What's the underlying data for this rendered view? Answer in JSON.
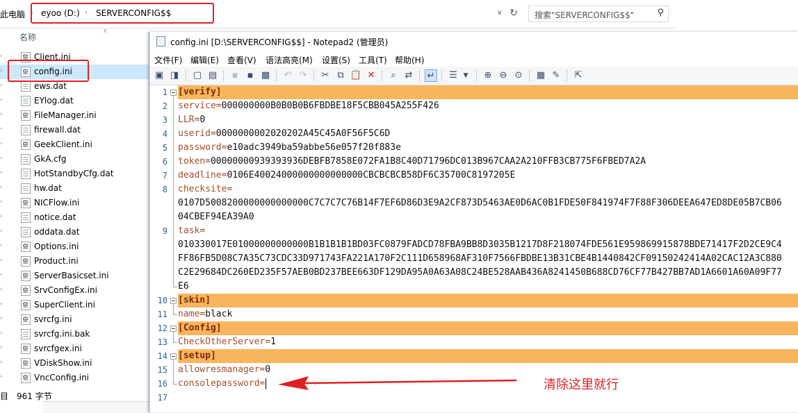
{
  "explorer": {
    "address": {
      "this_pc": "此电脑",
      "drive": "eyoo (D:)",
      "folder": "SERVERCONFIG$$"
    },
    "search_placeholder": "搜索\"SERVERCONFIG$$\"",
    "column_name": "名称",
    "files": [
      {
        "name": "Client.ini",
        "icon": "ini-file-icon"
      },
      {
        "name": "config.ini",
        "icon": "ini-file-icon",
        "selected": true
      },
      {
        "name": "ews.dat",
        "icon": "dat-file-icon"
      },
      {
        "name": "EYlog.dat",
        "icon": "dat-file-icon"
      },
      {
        "name": "FileManager.ini",
        "icon": "ini-file-icon"
      },
      {
        "name": "firewall.dat",
        "icon": "dat-file-icon"
      },
      {
        "name": "GeekClient.ini",
        "icon": "ini-file-icon"
      },
      {
        "name": "GkA.cfg",
        "icon": "cfg-file-icon"
      },
      {
        "name": "HotStandbyCfg.dat",
        "icon": "dat-file-icon"
      },
      {
        "name": "hw.dat",
        "icon": "dat-file-icon"
      },
      {
        "name": "NICFlow.ini",
        "icon": "ini-file-icon"
      },
      {
        "name": "notice.dat",
        "icon": "dat-file-icon"
      },
      {
        "name": "oddata.dat",
        "icon": "dat-file-icon"
      },
      {
        "name": "Options.ini",
        "icon": "ini-file-icon"
      },
      {
        "name": "Product.ini",
        "icon": "ini-file-icon"
      },
      {
        "name": "ServerBasicset.ini",
        "icon": "ini-file-icon"
      },
      {
        "name": "SrvConfigEx.ini",
        "icon": "ini-file-icon"
      },
      {
        "name": "SuperClient.ini",
        "icon": "ini-file-icon"
      },
      {
        "name": "svrcfg.ini",
        "icon": "ini-file-icon"
      },
      {
        "name": "svrcfg.ini.bak",
        "icon": "bak-file-icon"
      },
      {
        "name": "svrcfgex.ini",
        "icon": "ini-file-icon"
      },
      {
        "name": "VDiskShow.ini",
        "icon": "ini-file-icon"
      },
      {
        "name": "VncConfig.ini",
        "icon": "ini-file-icon"
      }
    ],
    "status": {
      "items": "目",
      "size": "961 字节"
    }
  },
  "notepad": {
    "title": "config.ini [D:\\SERVERCONFIG$$] - Notepad2 (管理员)",
    "menu": [
      "文件(F)",
      "编辑(E)",
      "查看(V)",
      "语法高亮(M)",
      "设置(S)",
      "工具(T)",
      "帮助(H)"
    ],
    "lines": [
      {
        "n": "1",
        "section": "[verify]"
      },
      {
        "n": "2",
        "key": "service",
        "value": "000000000B0B0B0B6FBDBE18F5CBB045A255F426"
      },
      {
        "n": "3",
        "key": "LLR",
        "value": "0"
      },
      {
        "n": "4",
        "key": "userid",
        "value": "0000000002020202A45C45A0F56F5C6D"
      },
      {
        "n": "5",
        "key": "password",
        "value": "e10adc3949ba59abbe56e057f20f883e"
      },
      {
        "n": "6",
        "key": "token",
        "value": "00000000939393936DEBFB7858E072FA1B8C40D71796DC013B967CAA2A210FFB3CB775F6FBED7A2A"
      },
      {
        "n": "7",
        "key": "deadline",
        "value": "0106E40024000000000000000CBCBCBCB58DF6C35700C8197205E"
      },
      {
        "n": "8",
        "key": "checksite",
        "value": "",
        "cont": [
          "0107D5008200000000000000C7C7C7C76B14F7EF6D86D3E9A2CF873D5463AE0D6AC0B1FDE50F841974F7F88F306DEEA647ED8DE05B7CB06",
          "04CBEF94EA39A0"
        ]
      },
      {
        "n": "9",
        "key": "task",
        "value": "",
        "cont": [
          "010330017E01000000000000B1B1B1B1BD03FC0879FADCD78FBA9BB8D3035B1217D8F218074FDE561E959869915878BDE71417F2D2CE9C4",
          "FF86FB5D08C7A35C73CDC33D971743FA221A170F2C111D658968AF310F7566FBDBE13B31CBE4B1440842CF09150242414A02CAC12A3C880",
          "C2E29684DC260ED235F57AEB0BD237BEE663DF129DA95A0A63A08C24BE528AAB436A8241450B688CD76CF77B427BB7AD1A6601A60A09F77",
          "E6"
        ]
      },
      {
        "n": "10",
        "section": "[skin]"
      },
      {
        "n": "11",
        "key": "name",
        "value": "black"
      },
      {
        "n": "12",
        "section": "[Config]"
      },
      {
        "n": "13",
        "key": "CheckOtherServer",
        "value": "1"
      },
      {
        "n": "14",
        "section": "[setup]"
      },
      {
        "n": "15",
        "key": "allowresmanager",
        "value": "0"
      },
      {
        "n": "16",
        "key": "consolepassword",
        "value": ""
      },
      {
        "n": "17"
      }
    ]
  },
  "annotation": {
    "text": "清除这里就行",
    "color": "#e02020"
  },
  "colors": {
    "section_band": "#f9b55d",
    "highlight_box": "#e02020",
    "line_numbers": "#2b5ea8"
  }
}
